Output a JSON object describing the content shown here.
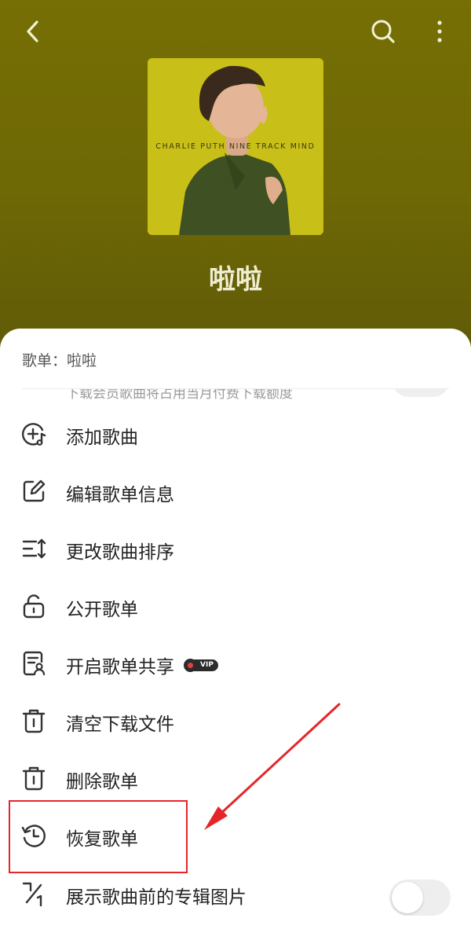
{
  "header": {
    "playlist_name": "啦啦",
    "back_icon": "back-arrow-icon",
    "search_icon": "search-icon",
    "more_icon": "more-vertical-icon",
    "cover_text": "CHARLIE PUTH NINE TRACK MIND",
    "background_color": "#766f05",
    "cover_color": "#c5bd17"
  },
  "sheet": {
    "title": "歌单：啦啦",
    "clipped_text": "下载会员歌曲将占用当月付费下载额度",
    "items": [
      {
        "label": "添加歌曲",
        "icon": "add-music-icon"
      },
      {
        "label": "编辑歌单信息",
        "icon": "edit-icon"
      },
      {
        "label": "更改歌曲排序",
        "icon": "sort-icon"
      },
      {
        "label": "公开歌单",
        "icon": "unlock-icon"
      },
      {
        "label": "开启歌单共享",
        "icon": "share-playlist-icon",
        "badge": "VIP"
      },
      {
        "label": "清空下载文件",
        "icon": "trash-icon"
      },
      {
        "label": "删除歌单",
        "icon": "trash-icon"
      },
      {
        "label": "恢复歌单",
        "icon": "restore-history-icon"
      },
      {
        "label": "展示歌曲前的专辑图片",
        "icon": "album-art-toggle-icon",
        "toggle": false
      }
    ]
  },
  "annotation": {
    "highlight_color": "#e5252a"
  }
}
